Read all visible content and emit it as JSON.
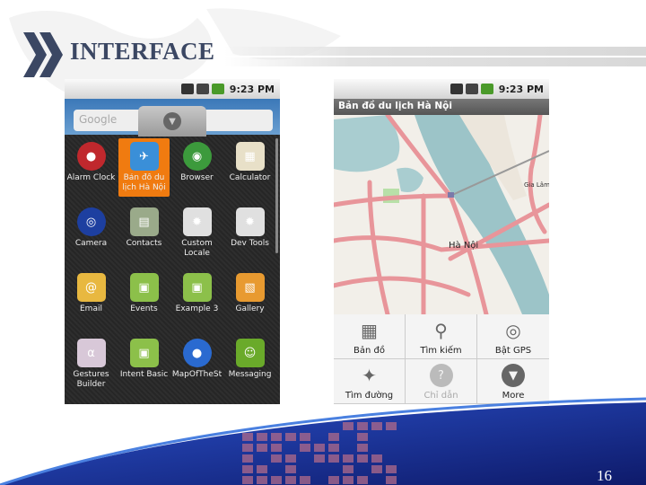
{
  "slide": {
    "title": "INTERFACE",
    "page_number": "16"
  },
  "status_bar": {
    "time": "9:23 PM",
    "icons": [
      "3g-icon",
      "signal-icon",
      "battery-icon"
    ]
  },
  "launcher": {
    "search_placeholder": "Google",
    "apps": [
      {
        "label": "Alarm Clock",
        "icon": "alarm-clock-icon",
        "color": "#c0282d"
      },
      {
        "label": "Bản đồ du\nlịch Hà Nội",
        "icon": "map-compass-icon",
        "color": "#3a8fd8",
        "selected": true
      },
      {
        "label": "Browser",
        "icon": "globe-icon",
        "color": "#3c9a3c"
      },
      {
        "label": "Calculator",
        "icon": "calculator-icon",
        "color": "#e8e0c8"
      },
      {
        "label": "Camera",
        "icon": "camera-icon",
        "color": "#1d3fa0"
      },
      {
        "label": "Contacts",
        "icon": "contacts-icon",
        "color": "#9aaa8a"
      },
      {
        "label": "Custom\nLocale",
        "icon": "gear-icon",
        "color": "#e0e0e0"
      },
      {
        "label": "Dev Tools",
        "icon": "gear-icon",
        "color": "#e0e0e0"
      },
      {
        "label": "Email",
        "icon": "email-icon",
        "color": "#e8b840"
      },
      {
        "label": "Events",
        "icon": "android-icon",
        "color": "#8cc04a"
      },
      {
        "label": "Example 3",
        "icon": "android-icon",
        "color": "#8cc04a"
      },
      {
        "label": "Gallery",
        "icon": "gallery-icon",
        "color": "#e89a30"
      },
      {
        "label": "Gestures\nBuilder",
        "icon": "gestures-icon",
        "color": "#d8c8d8"
      },
      {
        "label": "Intent Basic",
        "icon": "android-icon",
        "color": "#8cc04a"
      },
      {
        "label": "MapOfTheSt",
        "icon": "globe-small-icon",
        "color": "#2a6ad0"
      },
      {
        "label": "Messaging",
        "icon": "messaging-icon",
        "color": "#6aaa2a"
      }
    ]
  },
  "map_app": {
    "title": "Bản đồ du lịch Hà Nội",
    "map_labels": {
      "city": "Hà Nội",
      "district": "Gia Lâm"
    },
    "menu": [
      {
        "label": "Bản đồ",
        "icon": "map-icon",
        "enabled": true
      },
      {
        "label": "Tìm kiếm",
        "icon": "search-icon",
        "enabled": true
      },
      {
        "label": "Bật GPS",
        "icon": "gps-icon",
        "enabled": true
      },
      {
        "label": "Tìm đường",
        "icon": "compass-icon",
        "enabled": true
      },
      {
        "label": "Chỉ dẫn",
        "icon": "help-icon",
        "enabled": false
      },
      {
        "label": "More",
        "icon": "more-icon",
        "enabled": true
      }
    ]
  },
  "colors": {
    "title": "#3b4763",
    "selected_app": "#f07b10",
    "water": "#9cc4c8",
    "road": "#e8959a",
    "swoosh": "#1a2a8a"
  }
}
